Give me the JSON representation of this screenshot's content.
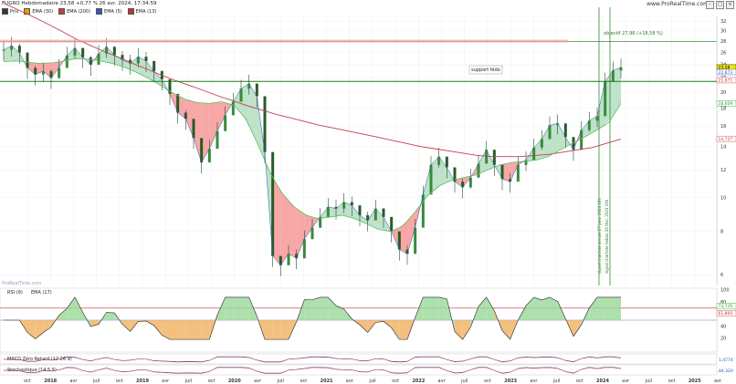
{
  "header": {
    "title": "FUGRO Hebdomadaire 23,58 +0,77 % 26 avr. 2024, 17:34:59",
    "brand": "www.ProRealTime.com",
    "legend": [
      {
        "label": "Prix",
        "color": "#3a3a3a"
      },
      {
        "label": "EMA (30)",
        "color": "#e0a000"
      },
      {
        "label": "EMA (200)",
        "color": "#c0404a"
      },
      {
        "label": "EMA (5)",
        "color": "#2a5ab8"
      },
      {
        "label": "EMA (13)",
        "color": "#c83030"
      }
    ]
  },
  "price_panel": {
    "annotations": {
      "support": "support fédo",
      "objective": "objectif 27,96 (+18,58 %)",
      "vert1": "signal chartiste annuel 27 janv. 2024 16h",
      "vert2": "signal chartiste hebdo 26 févr. 2024 16h"
    },
    "watermark": "ProRealTime.com",
    "price_tags": [
      {
        "text": "23,58",
        "color": "#f5e400",
        "fg": "#000",
        "value": 23.58
      },
      {
        "text": "22,873",
        "color": "#ffffff",
        "fg": "#2a5ab8",
        "value": 22.87
      },
      {
        "text": "21,671",
        "color": "#ffffff",
        "fg": "#c83030",
        "value": 21.67
      },
      {
        "text": "18,609",
        "color": "#ffffff",
        "fg": "#2aa02a",
        "value": 18.61
      },
      {
        "text": "14,727",
        "color": "#ffffff",
        "fg": "#c0404a",
        "value": 14.73
      }
    ]
  },
  "rsi_panel": {
    "label": "RSI (9)",
    "label2": "EMA (17)",
    "tags": [
      "73,726",
      "61,800"
    ]
  },
  "macd_panel": {
    "label": "MACD Zéro Retard (12 26 9)",
    "tag": "1,4774"
  },
  "stoch_panel": {
    "label": "Stochastique (14 5 5)",
    "tag": "84,320"
  },
  "chart_data": {
    "type": "line",
    "title": "FUGRO Hebdomadaire",
    "x_ticks": [
      "oct",
      "2018",
      "avr",
      "juil",
      "oct",
      "2019",
      "avr",
      "juil",
      "oct",
      "2020",
      "avr",
      "juil",
      "oct",
      "2021",
      "avr",
      "juil",
      "oct",
      "2022",
      "avr",
      "juil",
      "oct",
      "2023",
      "avr",
      "juil",
      "oct",
      "2024",
      "avr",
      "juil",
      "oct",
      "2025",
      "avr"
    ],
    "y_ticks_price": [
      32,
      30,
      28,
      26,
      24,
      22,
      20,
      18,
      16,
      14,
      12,
      10,
      8,
      6
    ],
    "y_ticks_rsi": [
      100,
      80,
      60,
      40,
      20
    ],
    "log_scale": true,
    "support_level": 21.5,
    "objective_level": 27.96,
    "series": [
      {
        "name": "Prix",
        "values": [
          26.5,
          27.2,
          26.0,
          23.5,
          22.5,
          23.0,
          22.0,
          23.5,
          25.5,
          26.8,
          25.2,
          24.0,
          25.8,
          27.0,
          25.6,
          24.8,
          24.2,
          25.3,
          24.6,
          23.0,
          21.8,
          19.8,
          17.5,
          16.8,
          14.8,
          12.6,
          13.8,
          15.5,
          17.2,
          18.8,
          20.5,
          21.2,
          19.5,
          13.5,
          6.8,
          6.4,
          6.9,
          6.7,
          7.6,
          8.2,
          8.8,
          9.4,
          9.3,
          9.7,
          9.5,
          8.9,
          8.6,
          9.3,
          8.8,
          8.0,
          7.1,
          6.9,
          8.2,
          10.2,
          12.4,
          13.1,
          12.2,
          11.1,
          10.7,
          11.4,
          12.5,
          13.7,
          12.4,
          11.3,
          11.1,
          12.4,
          12.8,
          13.9,
          14.7,
          16.1,
          16.3,
          14.9,
          13.7,
          15.6,
          16.6,
          17.1,
          21.5,
          23.1,
          23.6
        ]
      },
      {
        "name": "EMA (200)",
        "values": [
          36.0,
          34.5,
          33.0,
          31.5,
          30.0,
          28.5,
          27.3,
          26.2,
          25.2,
          24.2,
          23.3,
          22.4,
          21.6,
          20.9,
          20.2,
          19.5,
          18.9,
          18.3,
          17.8,
          17.3,
          16.9,
          16.5,
          16.1,
          15.8,
          15.5,
          15.2,
          14.9,
          14.6,
          14.3,
          14.0,
          13.8,
          13.6,
          13.4,
          13.2,
          13.1,
          13.1,
          13.1,
          13.2,
          13.3,
          13.5,
          13.7,
          13.9,
          14.3,
          14.7
        ]
      },
      {
        "name": "EMA (30)",
        "values": [
          24.5,
          24.6,
          24.4,
          24.2,
          24.3,
          24.6,
          25.0,
          24.9,
          24.6,
          24.2,
          23.6,
          22.8,
          21.9,
          20.9,
          19.9,
          19.1,
          18.7,
          18.6,
          18.8,
          18.4,
          16.8,
          14.2,
          11.8,
          10.3,
          9.4,
          8.9,
          8.7,
          8.8,
          8.9,
          8.7,
          8.4,
          8.1,
          8.0,
          8.3,
          9.1,
          10.1,
          10.8,
          11.2,
          11.4,
          11.6,
          12.0,
          12.4,
          12.6,
          12.7,
          12.8,
          13.1,
          13.7,
          14.3,
          14.9,
          15.6,
          16.4,
          18.6
        ]
      }
    ]
  }
}
